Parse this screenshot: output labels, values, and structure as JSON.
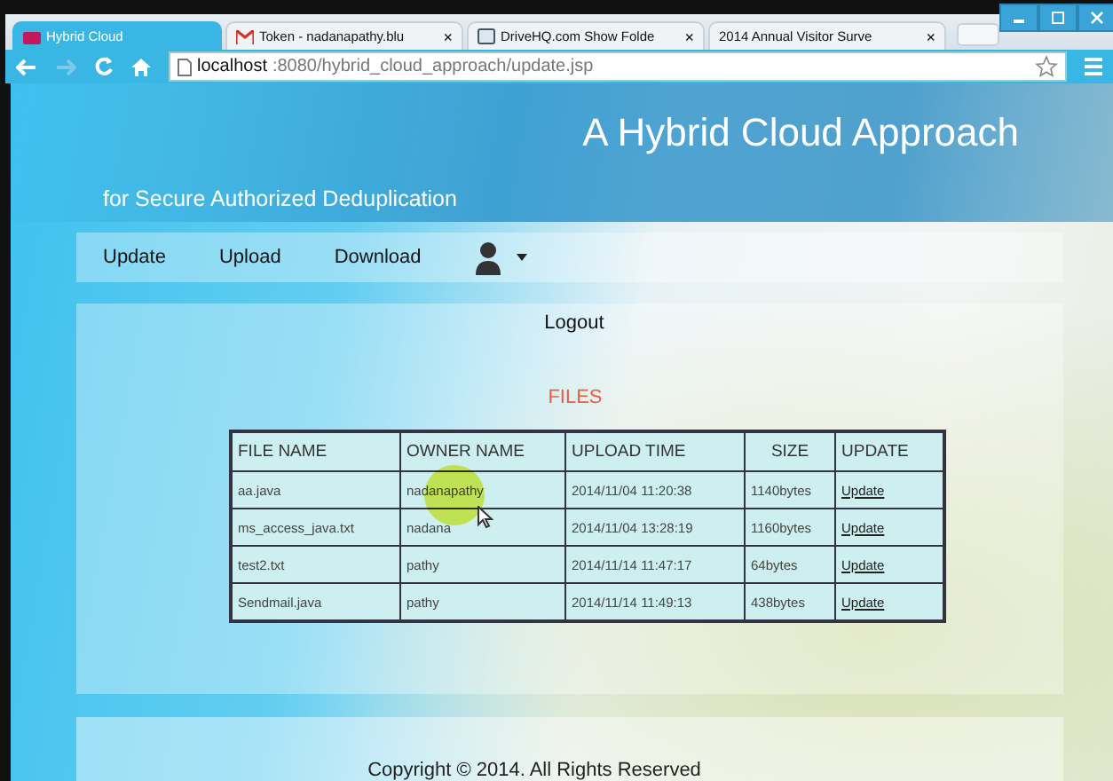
{
  "browser": {
    "tabs": [
      {
        "title": "Hybrid Cloud",
        "selected": true
      },
      {
        "title": "Token - nadanapathy.blu",
        "selected": false,
        "close": "×"
      },
      {
        "title": "DriveHQ.com Show Folde",
        "selected": false,
        "close": "×"
      },
      {
        "title": "2014 Annual Visitor Surve",
        "selected": false,
        "close": "×"
      }
    ],
    "url_host": "localhost",
    "url_rest": ":8080/hybrid_cloud_approach/update.jsp"
  },
  "header": {
    "title": "A Hybrid Cloud Approach",
    "subtitle": "for Secure Authorized Deduplication"
  },
  "nav": {
    "items": [
      "Update",
      "Upload",
      "Download"
    ],
    "user_menu": "Logout"
  },
  "files": {
    "heading": "FILES",
    "columns": [
      "FILE NAME",
      "OWNER NAME",
      "UPLOAD TIME",
      "SIZE",
      "UPDATE"
    ],
    "rows": [
      {
        "file": "aa.java",
        "owner": "nadanapathy",
        "time": "2014/11/04 11:20:38",
        "size": "1140bytes",
        "action": "Update"
      },
      {
        "file": "ms_access_java.txt",
        "owner": "nadana",
        "time": "2014/11/04 13:28:19",
        "size": "1160bytes",
        "action": "Update"
      },
      {
        "file": "test2.txt",
        "owner": "pathy",
        "time": "2014/11/14 11:47:17",
        "size": "64bytes",
        "action": "Update"
      },
      {
        "file": "Sendmail.java",
        "owner": "pathy",
        "time": "2014/11/14 11:49:13",
        "size": "438bytes",
        "action": "Update"
      }
    ]
  },
  "footer": "Copyright © 2014. All Rights Reserved"
}
